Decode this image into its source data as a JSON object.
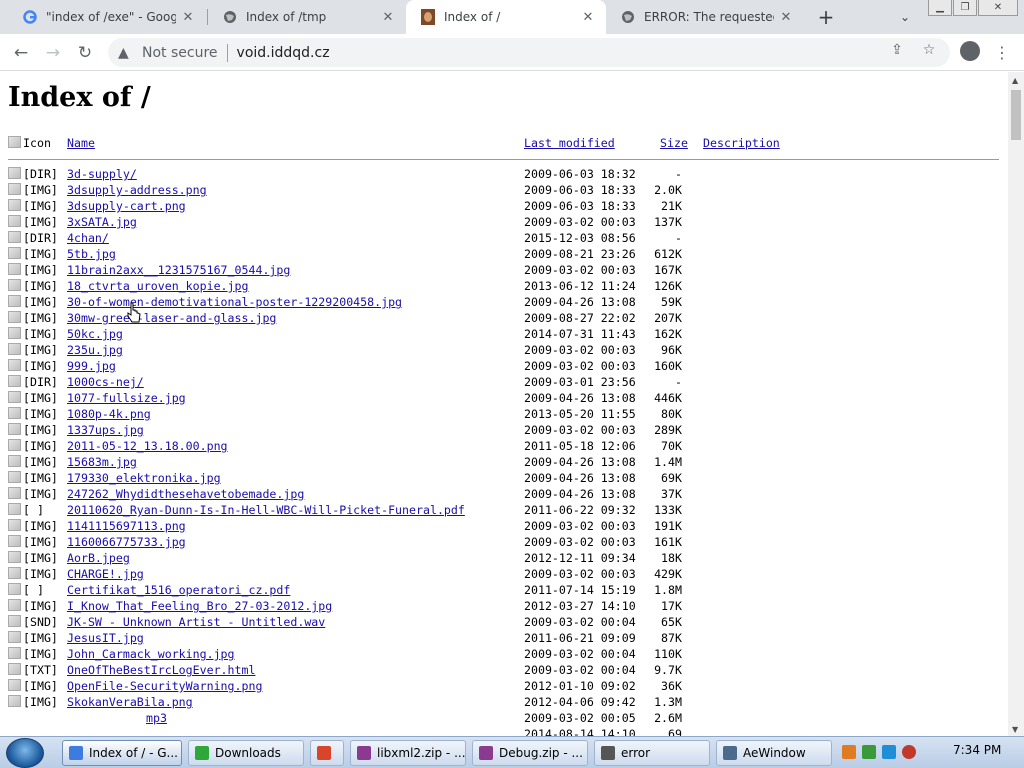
{
  "browser": {
    "tabs": [
      {
        "title": "\"index of /exe\" - Google S",
        "favicon": "google-icon",
        "active": false
      },
      {
        "title": "Index of /tmp",
        "favicon": "globe-icon",
        "active": false
      },
      {
        "title": "Index of /",
        "favicon": "site-photo-icon",
        "active": true
      },
      {
        "title": "ERROR: The requested UR",
        "favicon": "globe-icon",
        "active": false
      }
    ],
    "omnibox": {
      "security_label": "Not secure",
      "url": "void.iddqd.cz"
    }
  },
  "page": {
    "title": "Index of /",
    "columns": {
      "icon": "Icon",
      "name": "Name",
      "last_modified": "Last modified",
      "size": "Size",
      "description": "Description"
    },
    "entries": [
      {
        "icon": "[DIR]",
        "name": "3d-supply/",
        "date": "2009-06-03 18:32",
        "size": "-"
      },
      {
        "icon": "[IMG]",
        "name": "3dsupply-address.png",
        "date": "2009-06-03 18:33",
        "size": "2.0K"
      },
      {
        "icon": "[IMG]",
        "name": "3dsupply-cart.png",
        "date": "2009-06-03 18:33",
        "size": "21K"
      },
      {
        "icon": "[IMG]",
        "name": "3xSATA.jpg",
        "date": "2009-03-02 00:03",
        "size": "137K"
      },
      {
        "icon": "[DIR]",
        "name": "4chan/",
        "date": "2015-12-03 08:56",
        "size": "-"
      },
      {
        "icon": "[IMG]",
        "name": "5tb.jpg",
        "date": "2009-08-21 23:26",
        "size": "612K"
      },
      {
        "icon": "[IMG]",
        "name": "11brain2axx__1231575167_0544.jpg",
        "date": "2009-03-02 00:03",
        "size": "167K"
      },
      {
        "icon": "[IMG]",
        "name": "18_ctvrta_uroven_kopie.jpg",
        "date": "2013-06-12 11:24",
        "size": "126K"
      },
      {
        "icon": "[IMG]",
        "name": "30-of-women-demotivational-poster-1229200458.jpg",
        "date": "2009-04-26 13:08",
        "size": "59K"
      },
      {
        "icon": "[IMG]",
        "name": "30mw-green-laser-and-glass.jpg",
        "date": "2009-08-27 22:02",
        "size": "207K"
      },
      {
        "icon": "[IMG]",
        "name": "50kc.jpg",
        "date": "2014-07-31 11:43",
        "size": "162K"
      },
      {
        "icon": "[IMG]",
        "name": "235u.jpg",
        "date": "2009-03-02 00:03",
        "size": "96K"
      },
      {
        "icon": "[IMG]",
        "name": "999.jpg",
        "date": "2009-03-02 00:03",
        "size": "160K"
      },
      {
        "icon": "[DIR]",
        "name": "1000cs-nej/",
        "date": "2009-03-01 23:56",
        "size": "-"
      },
      {
        "icon": "[IMG]",
        "name": "1077-fullsize.jpg",
        "date": "2009-04-26 13:08",
        "size": "446K"
      },
      {
        "icon": "[IMG]",
        "name": "1080p-4k.png",
        "date": "2013-05-20 11:55",
        "size": "80K"
      },
      {
        "icon": "[IMG]",
        "name": "1337ups.jpg",
        "date": "2009-03-02 00:03",
        "size": "289K"
      },
      {
        "icon": "[IMG]",
        "name": "2011-05-12_13.18.00.png",
        "date": "2011-05-18 12:06",
        "size": "70K"
      },
      {
        "icon": "[IMG]",
        "name": "15683m.jpg",
        "date": "2009-04-26 13:08",
        "size": "1.4M"
      },
      {
        "icon": "[IMG]",
        "name": "179330_elektronika.jpg",
        "date": "2009-04-26 13:08",
        "size": "69K"
      },
      {
        "icon": "[IMG]",
        "name": "247262_Whydidthesehavetobemade.jpg",
        "date": "2009-04-26 13:08",
        "size": "37K"
      },
      {
        "icon": "[   ]",
        "name": "20110620_Ryan-Dunn-Is-In-Hell-WBC-Will-Picket-Funeral.pdf",
        "date": "2011-06-22 09:32",
        "size": "133K"
      },
      {
        "icon": "[IMG]",
        "name": "1141115697113.png",
        "date": "2009-03-02 00:03",
        "size": "191K"
      },
      {
        "icon": "[IMG]",
        "name": "1160066775733.jpg",
        "date": "2009-03-02 00:03",
        "size": "161K"
      },
      {
        "icon": "[IMG]",
        "name": "AorB.jpeg",
        "date": "2012-12-11 09:34",
        "size": "18K"
      },
      {
        "icon": "[IMG]",
        "name": "CHARGE!.jpg",
        "date": "2009-03-02 00:03",
        "size": "429K"
      },
      {
        "icon": "[   ]",
        "name": "Certifikat_1516_operatori_cz.pdf",
        "date": "2011-07-14 15:19",
        "size": "1.8M"
      },
      {
        "icon": "[IMG]",
        "name": "I_Know_That_Feeling_Bro_27-03-2012.jpg",
        "date": "2012-03-27 14:10",
        "size": "17K"
      },
      {
        "icon": "[SND]",
        "name": "JK-SW - Unknown Artist - Untitled.wav",
        "date": "2009-03-02 00:04",
        "size": "65K"
      },
      {
        "icon": "[IMG]",
        "name": "JesusIT.jpg",
        "date": "2011-06-21 09:09",
        "size": "87K"
      },
      {
        "icon": "[IMG]",
        "name": "John_Carmack_working.jpg",
        "date": "2009-03-02 00:04",
        "size": "110K"
      },
      {
        "icon": "[TXT]",
        "name": "OneOfTheBestIrcLogEver.html",
        "date": "2009-03-02 00:04",
        "size": "9.7K"
      },
      {
        "icon": "[IMG]",
        "name": "OpenFile-SecurityWarning.png",
        "date": "2012-01-10 09:02",
        "size": "36K"
      },
      {
        "icon": "[IMG]",
        "name": "SkokanVeraBila.png",
        "date": "2012-04-06 09:42",
        "size": "1.3M"
      },
      {
        "icon": "",
        "name": "mp3",
        "date": "2009-03-02 00:05",
        "size": "2.6M"
      },
      {
        "icon": "",
        "name": "",
        "date": "2014-08-14 14:10",
        "size": "69"
      }
    ]
  },
  "taskbar": {
    "items": [
      {
        "label": "Index of / - G...",
        "icon": "chrome-icon",
        "color": "#3d7be0",
        "active": true
      },
      {
        "label": "Downloads",
        "icon": "folder-icon",
        "color": "#2fa83a",
        "active": false
      },
      {
        "label": "",
        "icon": "media-player-icon",
        "color": "#d9452b",
        "active": false
      },
      {
        "label": "libxml2.zip - ...",
        "icon": "winrar-icon",
        "color": "#8a3b8f",
        "active": false
      },
      {
        "label": "Debug.zip - ...",
        "icon": "winrar-icon",
        "color": "#8a3b8f",
        "active": false
      },
      {
        "label": "error",
        "icon": "cmd-icon",
        "color": "#555555",
        "active": false
      },
      {
        "label": "AeWindow",
        "icon": "app-window-icon",
        "color": "#4a6b8c",
        "active": false
      }
    ],
    "clock": "7:34 PM"
  },
  "colors": {
    "link": "#1a0dab",
    "visited": "#681da8"
  }
}
